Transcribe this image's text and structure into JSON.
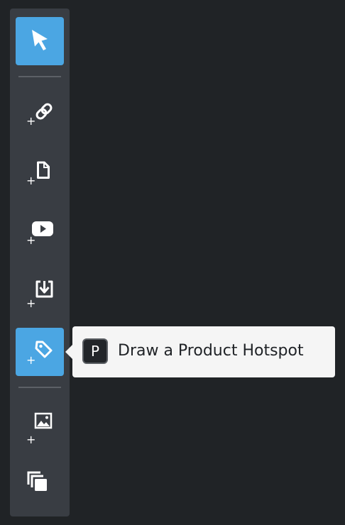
{
  "toolbar": {
    "tools": [
      {
        "icon": "pointer-icon",
        "active": true
      },
      {
        "icon": "add-link-icon",
        "active": false
      },
      {
        "icon": "add-document-icon",
        "active": false
      },
      {
        "icon": "add-youtube-video-icon",
        "active": false
      },
      {
        "icon": "add-download-icon",
        "active": false
      },
      {
        "icon": "add-product-hotspot-icon",
        "active": true
      },
      {
        "icon": "add-image-icon",
        "active": false
      },
      {
        "icon": "duplicate-layers-icon",
        "active": false
      }
    ]
  },
  "tooltip": {
    "shortcut_key": "P",
    "text": "Draw a Product Hotspot"
  },
  "colors": {
    "background": "#202326",
    "toolbar": "#393d43",
    "accent": "#4ba6e3",
    "tooltip_bg": "#f5f5f5"
  }
}
